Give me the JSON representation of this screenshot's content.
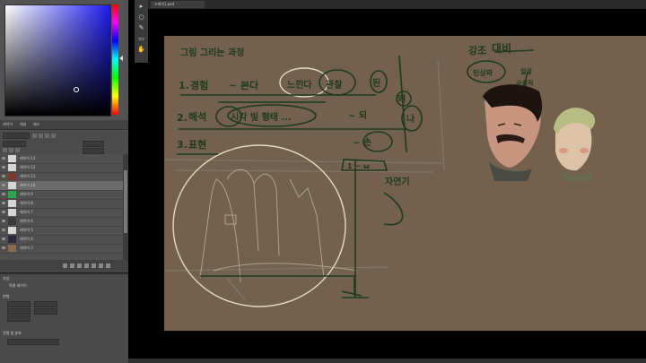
{
  "window": {
    "document_tab": "스케치1.psd"
  },
  "layers_panel": {
    "tabs": [
      "레이어",
      "채널",
      "패스"
    ],
    "layers": [
      {
        "name": "레이어 13",
        "selected": false
      },
      {
        "name": "레이어 12",
        "selected": false
      },
      {
        "name": "레이어 11",
        "selected": false
      },
      {
        "name": "레이어 10",
        "selected": true
      },
      {
        "name": "레이어 9",
        "selected": false
      },
      {
        "name": "레이어 8",
        "selected": false
      },
      {
        "name": "레이어 7",
        "selected": false
      },
      {
        "name": "레이어 6",
        "selected": false
      },
      {
        "name": "레이어 5",
        "selected": false
      },
      {
        "name": "레이어 4",
        "selected": false
      },
      {
        "name": "레이어 3",
        "selected": false
      }
    ]
  },
  "properties_panel": {
    "title": "속성",
    "subtitle": "픽셀 레이어",
    "section_transform": "변형",
    "section_align": "정렬 및 분포"
  },
  "colors": {
    "canvas": "#73604d",
    "sketch_green": "#1f3a1c",
    "highlight_cream": "#e8d8c0",
    "panel": "#535353"
  },
  "tools": [
    "move-icon",
    "lasso-icon",
    "brush-icon",
    "eraser-icon",
    "hand-icon"
  ],
  "canvas_notes": {
    "heading": "그림 그리는 과정",
    "step1_num": "1.",
    "step1_a": "경험",
    "step1_b": "~ 본다",
    "step1_c": "느낀다",
    "step1_d": "관찰",
    "step1_e": "된",
    "step1_f": "왜",
    "step2_num": "2.",
    "step2_a": "해석",
    "step2_b": "시각 빛 형태 ...",
    "step2_c": "~ 되",
    "step2_d": "나",
    "step3_num": "3.",
    "step3_a": "표현",
    "step3_b": "~ 손",
    "box_label": "1 ~ ω",
    "nature_label": "자연기",
    "contrast_a": "강조",
    "contrast_b": "대비",
    "tag1": "인상파",
    "tag2a": "얼굴",
    "tag2b": "사실적"
  }
}
